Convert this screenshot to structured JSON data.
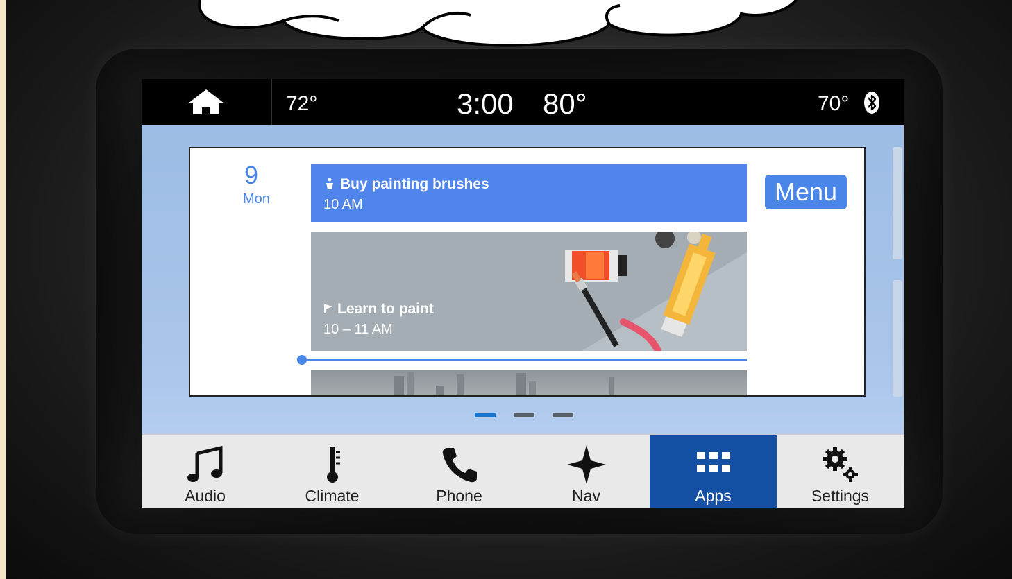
{
  "status_bar": {
    "temp_left": "72°",
    "time": "3:00",
    "outside_temp": "80°",
    "temp_right": "70°"
  },
  "calendar": {
    "day_number": "9",
    "day_of_week": "Mon",
    "events": [
      {
        "title": "Buy painting brushes",
        "time": "10 AM",
        "icon": "person-walk-icon"
      },
      {
        "title": "Learn to paint",
        "time": "10 – 11 AM",
        "icon": "flag-icon"
      }
    ],
    "menu_label": "Menu"
  },
  "pager": {
    "count": 3,
    "active": 0
  },
  "dock": {
    "items": [
      {
        "label": "Audio",
        "icon": "music-note-icon"
      },
      {
        "label": "Climate",
        "icon": "thermometer-icon"
      },
      {
        "label": "Phone",
        "icon": "phone-icon"
      },
      {
        "label": "Nav",
        "icon": "nav-star-icon"
      },
      {
        "label": "Apps",
        "icon": "apps-grid-icon"
      },
      {
        "label": "Settings",
        "icon": "gears-icon"
      }
    ],
    "active_item": "Apps"
  },
  "colors": {
    "accent": "#4a86e8",
    "active_tab": "#1451a5",
    "event_blue": "#5086ec"
  }
}
